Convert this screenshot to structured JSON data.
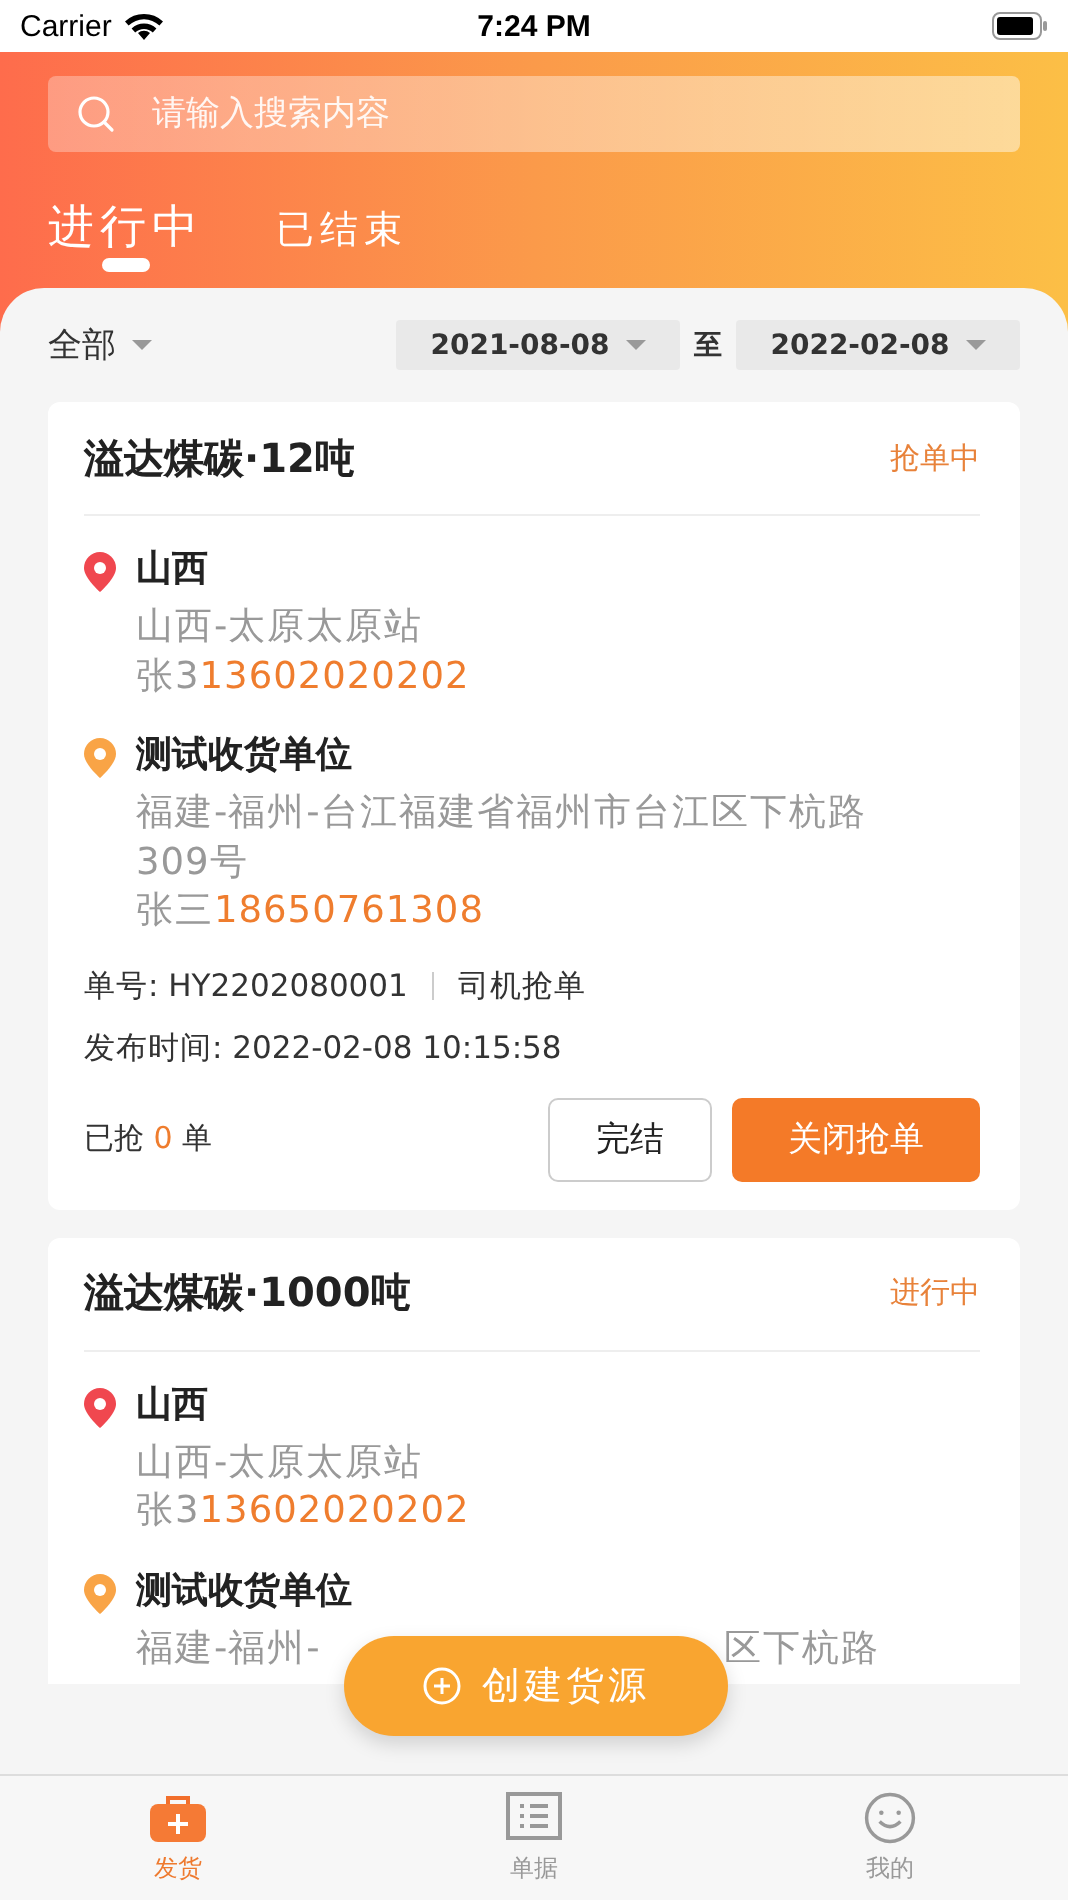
{
  "status_bar": {
    "carrier": "Carrier",
    "time": "7:24 PM"
  },
  "search": {
    "placeholder": "请输入搜索内容"
  },
  "tabs": [
    {
      "label": "进行中",
      "selected": true
    },
    {
      "label": "已结束",
      "selected": false
    }
  ],
  "filter": {
    "category": "全部",
    "date_from": "2021-08-08",
    "separator": "至",
    "date_to": "2022-02-08"
  },
  "orders": [
    {
      "title": "溢达煤碳·12吨",
      "status": "抢单中",
      "origin": {
        "name": "山西",
        "address": "山西-太原太原站",
        "contact": "张3",
        "phone": "13602020202"
      },
      "destination": {
        "name": "测试收货单位",
        "address": "福建-福州-台江福建省福州市台江区下杭路309号",
        "contact": "张三",
        "phone": "18650761308"
      },
      "order_no_label": "单号:",
      "order_no": "HY2202080001",
      "order_type": "司机抢单",
      "publish_label": "发布时间:",
      "publish_time": "2022-02-08 10:15:58",
      "grabbed": {
        "label": "已抢",
        "count": "0",
        "unit": "单"
      },
      "buttons": [
        {
          "label": "完结",
          "kind": "outline"
        },
        {
          "label": "关闭抢单",
          "kind": "primary"
        }
      ]
    },
    {
      "title": "溢达煤碳·1000吨",
      "status": "进行中",
      "origin": {
        "name": "山西",
        "address": "山西-太原太原站",
        "contact": "张3",
        "phone": "13602020202"
      },
      "destination": {
        "name": "测试收货单位",
        "address_parts": [
          "福建-福州-",
          "区下杭路"
        ]
      }
    }
  ],
  "fab": {
    "label": "创建货源"
  },
  "tab_bar": [
    {
      "label": "发货",
      "kind": "ship",
      "selected": true
    },
    {
      "label": "单据",
      "kind": "list",
      "selected": false
    },
    {
      "label": "我的",
      "kind": "profile",
      "selected": false
    }
  ]
}
